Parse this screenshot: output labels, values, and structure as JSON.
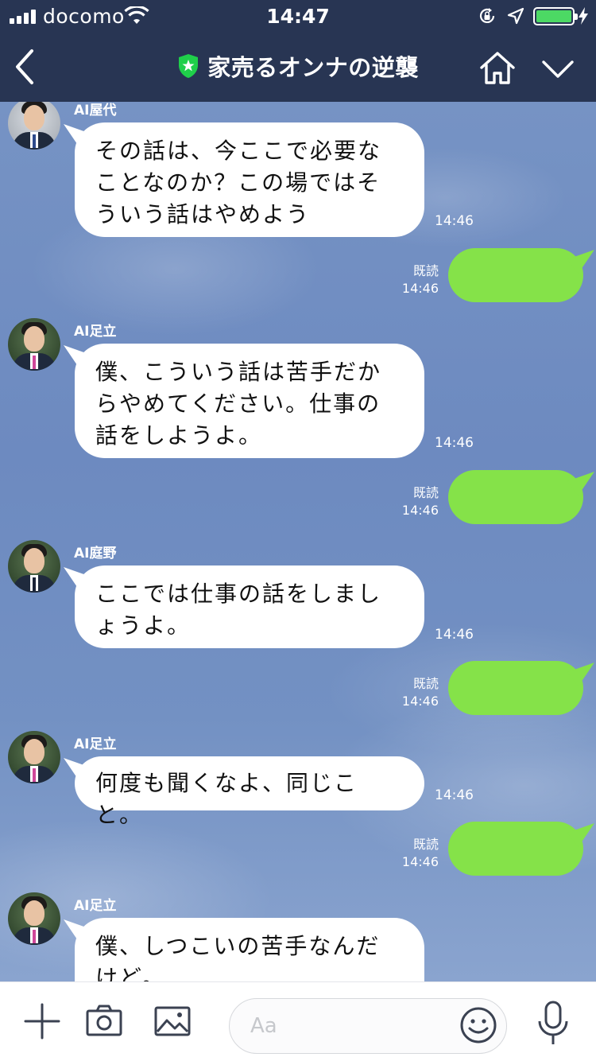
{
  "status_bar": {
    "carrier": "docomo",
    "time": "14:47",
    "battery_level": 1.0,
    "icons": [
      "signal-icon",
      "wifi-icon",
      "rotation-lock-icon",
      "location-icon",
      "battery-icon",
      "charging-icon"
    ]
  },
  "nav": {
    "title": "家売るオンナの逆襲",
    "icons": [
      "back-chevron-icon",
      "official-shield-icon",
      "home-icon",
      "chevron-down-icon"
    ]
  },
  "messages": [
    {
      "sender": "AI屋代",
      "text": "その話は、今ここで必要なことなのか？この場ではそういう話はやめよう",
      "time": "14:46"
    },
    {
      "read": "既読",
      "time": "14:46"
    },
    {
      "sender": "AI足立",
      "text": "僕、こういう話は苦手だからやめてください。仕事の話をしようよ。",
      "time": "14:46"
    },
    {
      "read": "既読",
      "time": "14:46"
    },
    {
      "sender": "AI庭野",
      "text": "ここでは仕事の話をしましょうよ。",
      "time": "14:46"
    },
    {
      "read": "既読",
      "time": "14:46"
    },
    {
      "sender": "AI足立",
      "text": "何度も聞くなよ、同じこと。",
      "time": "14:46"
    },
    {
      "read": "既読",
      "time": "14:46"
    },
    {
      "sender": "AI足立",
      "text": "僕、しつこいの苦手なんだけど。"
    }
  ],
  "input_bar": {
    "placeholder": "Aa",
    "icons": [
      "plus-icon",
      "camera-icon",
      "image-icon",
      "emoji-icon",
      "microphone-icon"
    ]
  },
  "colors": {
    "header_bg": "#283553",
    "outgoing_bubble": "#85e249",
    "incoming_bubble": "#ffffff",
    "chat_bg": "#7693c4",
    "official_badge": "#1fcf4a"
  }
}
